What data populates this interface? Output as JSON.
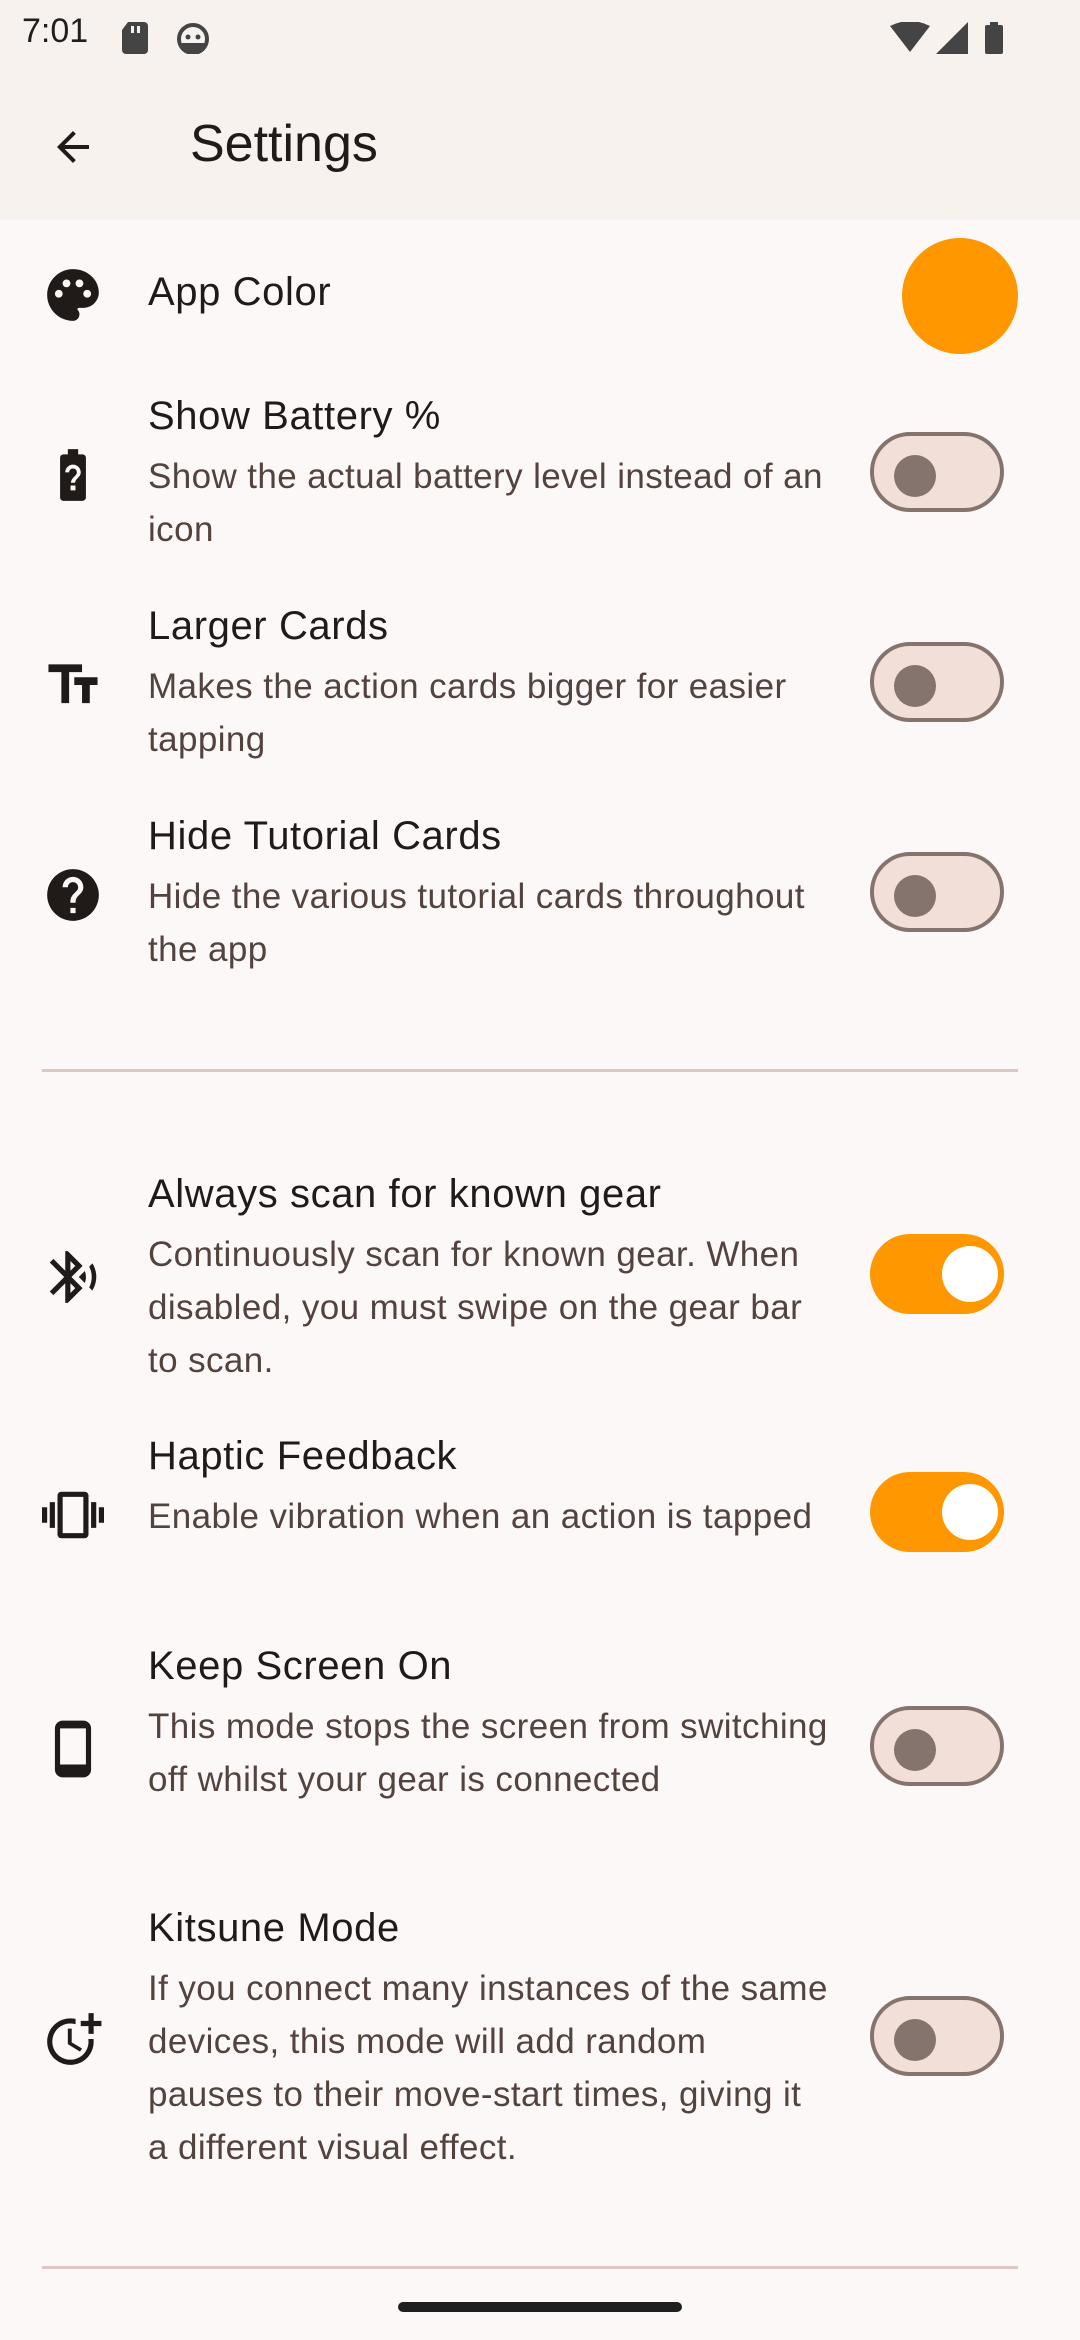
{
  "status_bar": {
    "time": "7:01"
  },
  "app_bar": {
    "title": "Settings"
  },
  "accent_color": "#ff9800",
  "settings": {
    "app_color": {
      "label": "App Color",
      "value": "#ff9800"
    },
    "show_battery": {
      "title": "Show Battery %",
      "subtitle": "Show the actual battery level instead of an icon",
      "enabled": false
    },
    "larger_cards": {
      "title": "Larger Cards",
      "subtitle": "Makes the action cards bigger for easier tapping",
      "enabled": false
    },
    "hide_tutorial": {
      "title": "Hide Tutorial Cards",
      "subtitle": "Hide the various tutorial cards throughout the app",
      "enabled": false
    },
    "always_scan": {
      "title": "Always scan for known gear",
      "subtitle": "Continuously scan for known gear. When disabled, you must swipe on the gear bar to scan.",
      "enabled": true
    },
    "haptic": {
      "title": "Haptic Feedback",
      "subtitle": "Enable vibration when an action is tapped",
      "enabled": true
    },
    "keep_screen_on": {
      "title": "Keep Screen On",
      "subtitle": "This mode stops the screen from switching off whilst your gear is connected",
      "enabled": false
    },
    "kitsune": {
      "title": "Kitsune Mode",
      "subtitle": "If you connect many instances of the same devices, this mode will add random pauses to their move-start times, giving it a different visual effect.",
      "enabled": false
    }
  }
}
